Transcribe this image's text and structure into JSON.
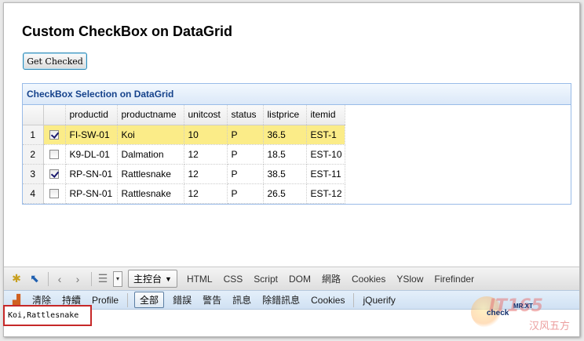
{
  "page": {
    "title": "Custom CheckBox on DataGrid"
  },
  "toolbar": {
    "get_checked_label": "Get Checked"
  },
  "datagrid": {
    "title": "CheckBox Selection on DataGrid",
    "columns": [
      "productid",
      "productname",
      "unitcost",
      "status",
      "listprice",
      "itemid"
    ],
    "rows": [
      {
        "num": "1",
        "checked": true,
        "productid": "FI-SW-01",
        "productname": "Koi",
        "unitcost": "10",
        "status": "P",
        "listprice": "36.5",
        "itemid": "EST-1"
      },
      {
        "num": "2",
        "checked": false,
        "productid": "K9-DL-01",
        "productname": "Dalmation",
        "unitcost": "12",
        "status": "P",
        "listprice": "18.5",
        "itemid": "EST-10"
      },
      {
        "num": "3",
        "checked": true,
        "productid": "RP-SN-01",
        "productname": "Rattlesnake",
        "unitcost": "12",
        "status": "P",
        "listprice": "38.5",
        "itemid": "EST-11"
      },
      {
        "num": "4",
        "checked": false,
        "productid": "RP-SN-01",
        "productname": "Rattlesnake",
        "unitcost": "12",
        "status": "P",
        "listprice": "26.5",
        "itemid": "EST-12"
      }
    ],
    "selected_row_color": "#fbec88"
  },
  "firebug": {
    "console_tab": "主控台",
    "tabs": [
      "HTML",
      "CSS",
      "Script",
      "DOM",
      "網路",
      "Cookies",
      "YSlow",
      "Firefinder"
    ],
    "console_toolbar": {
      "clear": "清除",
      "persist": "持續",
      "profile": "Profile",
      "all": "全部",
      "errors": "錯誤",
      "warnings": "警告",
      "info": "訊息",
      "debug": "除錯訊息",
      "cookies": "Cookies",
      "jquerify": "jQuerify"
    },
    "output": "Koi,Rattlesnake"
  },
  "watermark": {
    "brand": "IT165",
    "cn": "汉风五方",
    "check": "check",
    "mr": "MR.XT"
  }
}
